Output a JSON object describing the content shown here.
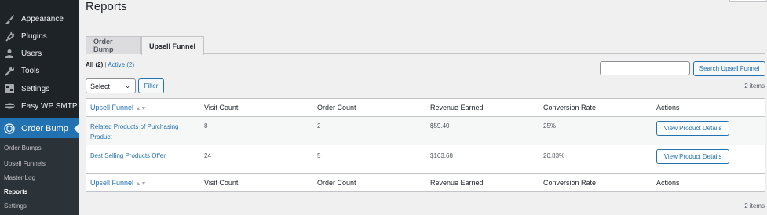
{
  "sidebar": {
    "items": [
      {
        "label": "Appearance",
        "icon": "paintbrush-icon"
      },
      {
        "label": "Plugins",
        "icon": "plugin-icon"
      },
      {
        "label": "Users",
        "icon": "user-icon"
      },
      {
        "label": "Tools",
        "icon": "wrench-icon"
      },
      {
        "label": "Settings",
        "icon": "settings-icon"
      },
      {
        "label": "Easy WP SMTP",
        "icon": "smtp-icon"
      },
      {
        "label": "Order Bump",
        "icon": "order-bump-icon"
      }
    ],
    "submenu": [
      "Order Bumps",
      "Upsell Funnels",
      "Master Log",
      "Reports",
      "Settings"
    ],
    "current_submenu": "Reports"
  },
  "page": {
    "title": "Reports"
  },
  "tabs": [
    {
      "label": "Order Bump",
      "active": false
    },
    {
      "label": "Upsell Funnel",
      "active": true
    }
  ],
  "filters": {
    "all_label": "All",
    "all_count": "(2)",
    "separator": "|",
    "active_label": "Active (2)"
  },
  "search": {
    "placeholder": "",
    "button_label": "Search Upsell Funnel"
  },
  "bulk": {
    "select_value": "Select",
    "filter_label": "Filter"
  },
  "items_count": "2 items",
  "table": {
    "columns": [
      "Upsell Funnel",
      "Visit Count",
      "Order Count",
      "Revenue Earned",
      "Conversion Rate",
      "Actions"
    ],
    "rows": [
      {
        "name": "Related Products of Purchasing Product",
        "name_line1": "Related Products of Purchasing",
        "name_line2": "Product",
        "visits": "8",
        "orders": "2",
        "revenue": "$59.40",
        "conversion": "25%",
        "action": "View Product Details"
      },
      {
        "name": "Best Selling Products Offer",
        "visits": "24",
        "orders": "5",
        "revenue": "$163.68",
        "conversion": "20.83%",
        "action": "View Product Details"
      }
    ]
  },
  "colors": {
    "accent": "#2271b1",
    "sidebar_bg": "#1d2327",
    "page_bg": "#f0f0f1"
  }
}
